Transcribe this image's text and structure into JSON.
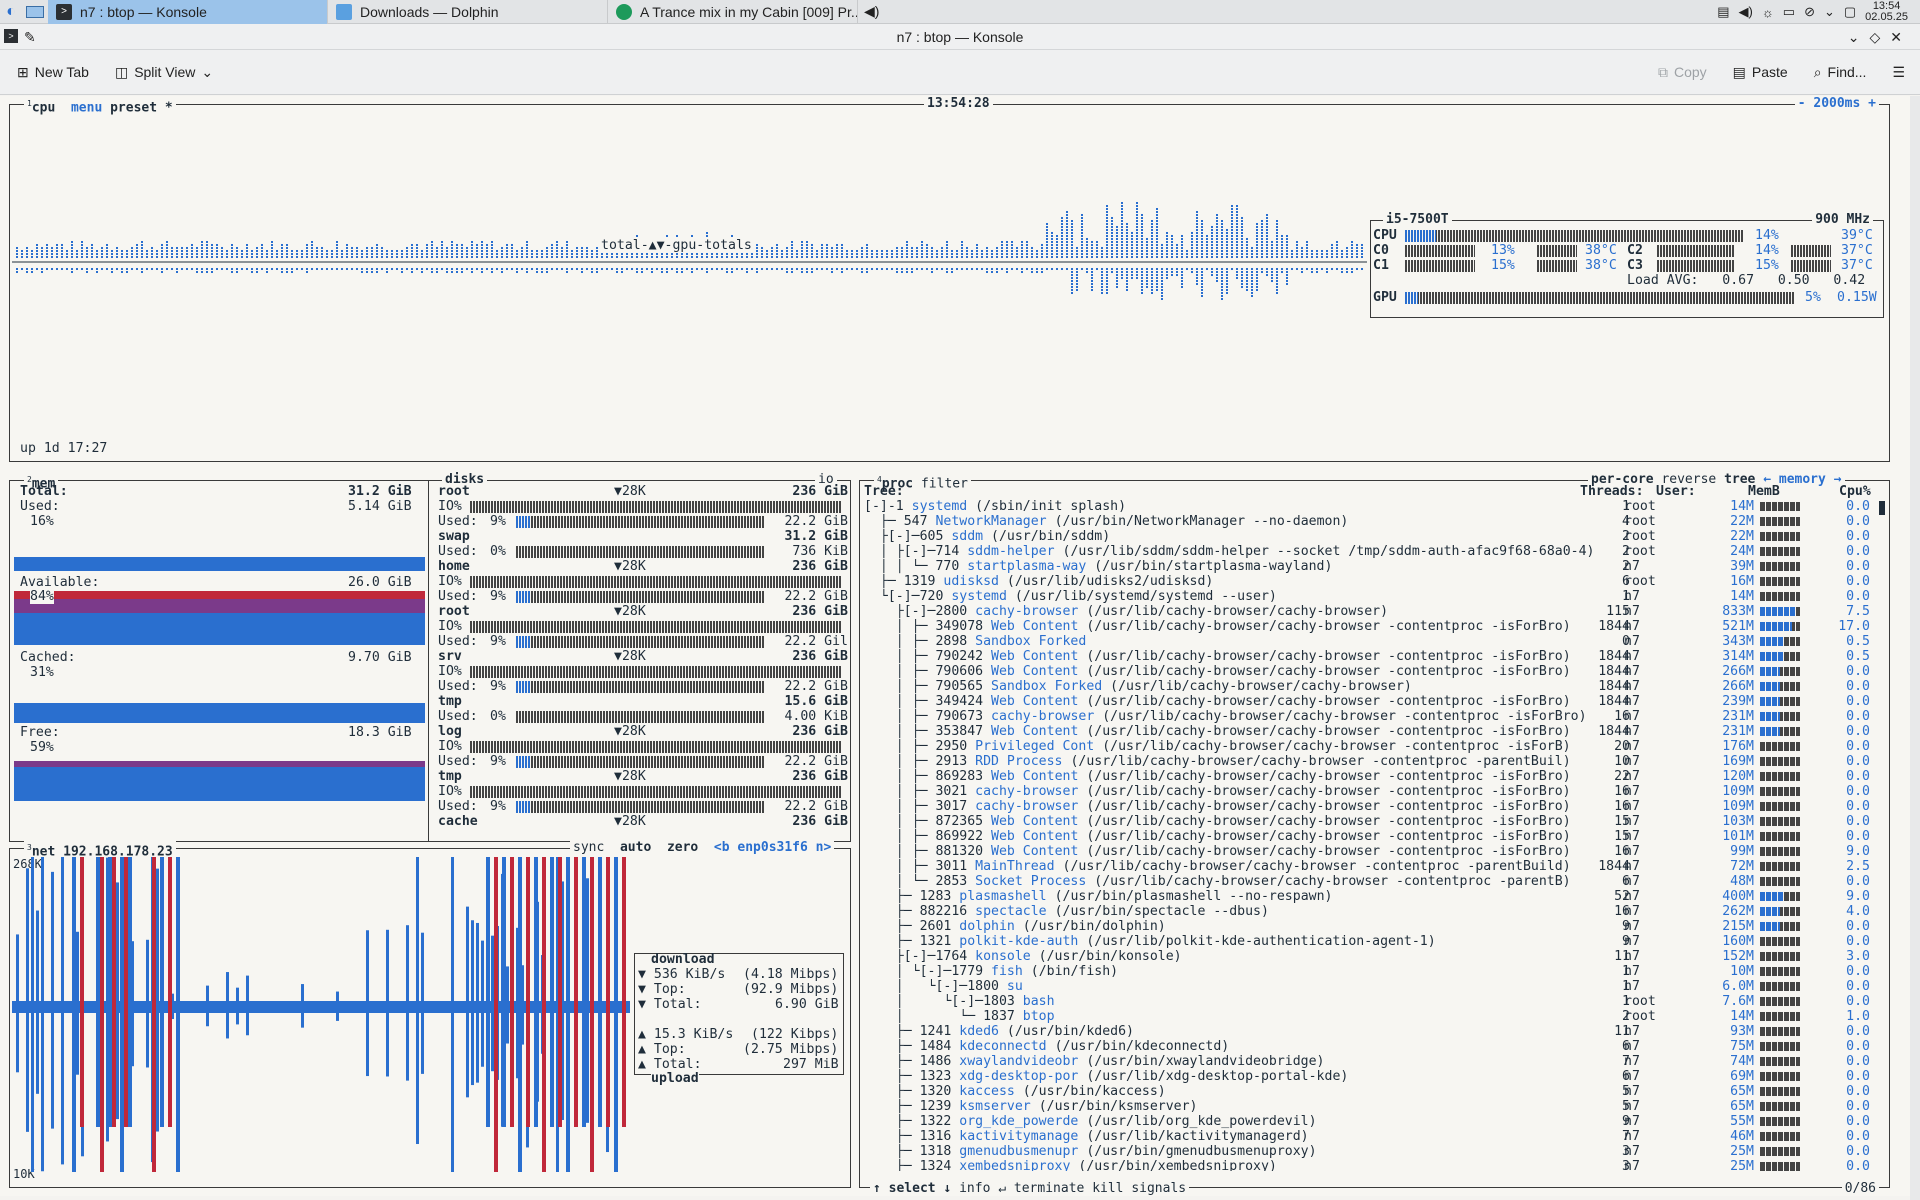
{
  "taskbar": {
    "apps": [
      {
        "label": "n7 : btop — Konsole",
        "active": true
      },
      {
        "label": "Downloads — Dolphin",
        "active": false
      },
      {
        "label": "A Trance mix in my Cabin [009] Pr...",
        "active": false
      }
    ],
    "clock": {
      "time": "13:54",
      "date": "02.05.25"
    }
  },
  "window": {
    "title": "n7 : btop — Konsole"
  },
  "toolbar": {
    "new_tab": "New Tab",
    "split_view": "Split View",
    "copy": "Copy",
    "paste": "Paste",
    "find": "Find..."
  },
  "cpu": {
    "label_num": "1",
    "label": "cpu",
    "menu": "menu",
    "preset": "preset *",
    "time": "13:54:28",
    "interval": "- 2000ms +",
    "graph_label": "total-▲▼-gpu-totals",
    "uptime": "up 1d 17:27",
    "model": "i5-7500T",
    "freq": "900 MHz",
    "cores": [
      {
        "name": "CPU",
        "pct": "14%",
        "temp": "39°C",
        "value": 14
      },
      {
        "name": "C0",
        "pct": "13%",
        "temp": "38°C",
        "value": 13
      },
      {
        "name": "C2",
        "pct": "14%",
        "temp": "37°C",
        "value": 14
      },
      {
        "name": "C1",
        "pct": "15%",
        "temp": "38°C",
        "value": 15
      },
      {
        "name": "C3",
        "pct": "15%",
        "temp": "37°C",
        "value": 15
      }
    ],
    "load_avg": "Load AVG:   0.67   0.50   0.42",
    "gpu": {
      "name": "GPU",
      "pct": "5%",
      "power": "0.15W",
      "value": 5
    }
  },
  "mem": {
    "label_num": "2",
    "label": "mem",
    "total_label": "Total:",
    "total": "31.2 GiB",
    "rows": [
      {
        "label": "Used:",
        "value": "5.14 GiB",
        "pct": "16%"
      },
      {
        "label": "Available:",
        "value": "26.0 GiB",
        "pct": "84%"
      },
      {
        "label": "Cached:",
        "value": "9.70 GiB",
        "pct": "31%"
      },
      {
        "label": "Free:",
        "value": "18.3 GiB",
        "pct": "59%"
      }
    ]
  },
  "disks": {
    "label": "disks",
    "io": "io",
    "items": [
      {
        "name": "root",
        "io_speed": "▼28K",
        "size": "236 GiB",
        "io": "IO%",
        "used": "Used:",
        "pct": "9%",
        "used_val": "22.2 GiB",
        "used_frac": 0.09
      },
      {
        "name": "swap",
        "io_speed": "",
        "size": "31.2 GiB",
        "io": "",
        "used": "Used:",
        "pct": "0%",
        "used_val": "736 KiB",
        "used_frac": 0
      },
      {
        "name": "home",
        "io_speed": "▼28K",
        "size": "236 GiB",
        "io": "IO%",
        "used": "Used:",
        "pct": "9%",
        "used_val": "22.2 GiB",
        "used_frac": 0.09
      },
      {
        "name": "root",
        "io_speed": "▼28K",
        "size": "236 GiB",
        "io": "IO%",
        "used": "Used:",
        "pct": "9%",
        "used_val": "22.2 Gil",
        "used_frac": 0.09
      },
      {
        "name": "srv",
        "io_speed": "▼28K",
        "size": "236 GiB",
        "io": "IO%",
        "used": "Used:",
        "pct": "9%",
        "used_val": "22.2 GiB",
        "used_frac": 0.09
      },
      {
        "name": "tmp",
        "io_speed": "",
        "size": "15.6 GiB",
        "io": "",
        "used": "Used:",
        "pct": "0%",
        "used_val": "4.00 KiB",
        "used_frac": 0
      },
      {
        "name": "log",
        "io_speed": "▼28K",
        "size": "236 GiB",
        "io": "IO%",
        "used": "Used:",
        "pct": "9%",
        "used_val": "22.2 GiB",
        "used_frac": 0.09
      },
      {
        "name": "tmp",
        "io_speed": "▼28K",
        "size": "236 GiB",
        "io": "IO%",
        "used": "Used:",
        "pct": "9%",
        "used_val": "22.2 GiB",
        "used_frac": 0.09
      },
      {
        "name": "cache",
        "io_speed": "▼28K",
        "size": "236 GiB",
        "io": "",
        "used": "",
        "pct": "",
        "used_val": "",
        "used_frac": 0
      }
    ]
  },
  "net": {
    "label_num": "3",
    "label": "net",
    "ip": "192.168.178.23",
    "sync": "sync",
    "auto": "auto",
    "zero": "zero",
    "iface": "<b enp0s31f6 n>",
    "top_scale": "268K",
    "bottom_scale": "10K",
    "download": {
      "title": "download",
      "rate": "536 KiB/s",
      "rate_mbps": "(4.18 Mibps)",
      "top_label": "Top:",
      "top": "(92.9 Mibps)",
      "total_label": "Total:",
      "total": "6.90 GiB"
    },
    "upload": {
      "title": "upload",
      "rate": "15.3 KiB/s",
      "rate_mbps": "(122 Kibps)",
      "top_label": "Top:",
      "top": "(2.75 Mibps)",
      "total_label": "Total:",
      "total": "297 MiB"
    }
  },
  "proc": {
    "label_num": "4",
    "label": "proc",
    "filter": "filter",
    "per_core": "per-core",
    "reverse": "reverse",
    "tree": "tree",
    "sort": "← memory →",
    "headers": {
      "tree": "Tree:",
      "threads": "Threads:",
      "user": "User:",
      "mem": "MemB",
      "cpu": "Cpu%"
    },
    "footer": {
      "select": "↑ select ↓",
      "info": "info ↵",
      "terminate": "terminate",
      "kill": "kill",
      "signals": "signals",
      "count": "0/86"
    },
    "rows": [
      {
        "prefix": "[-]-1 ",
        "name": "systemd",
        "cmd": " (/sbin/init splash)",
        "threads": "1",
        "user": "root",
        "mem": "14M",
        "cpu": "0.0",
        "bar": 0.4
      },
      {
        "prefix": "  ├─ 547 ",
        "name": "NetworkManager",
        "cmd": " (/usr/bin/NetworkManager --no-daemon)",
        "threads": "4",
        "user": "root",
        "mem": "22M",
        "cpu": "0.0",
        "bar": 0.4
      },
      {
        "prefix": "  ├[-]─605 ",
        "name": "sddm",
        "cmd": " (/usr/bin/sddm)",
        "threads": "2",
        "user": "root",
        "mem": "22M",
        "cpu": "0.0",
        "bar": 0.4
      },
      {
        "prefix": "  │ ├[-]─714 ",
        "name": "sddm-helper",
        "cmd": " (/usr/lib/sddm/sddm-helper --socket /tmp/sddm-auth-afac9f68-68a0-4)",
        "threads": "2",
        "user": "root",
        "mem": "24M",
        "cpu": "0.0",
        "bar": 0.4
      },
      {
        "prefix": "  │ │ └─ 770 ",
        "name": "startplasma-way",
        "cmd": " (/usr/bin/startplasma-wayland)",
        "threads": "2",
        "user": "n7",
        "mem": "39M",
        "cpu": "0.0",
        "bar": 0.4
      },
      {
        "prefix": "  ├─ 1319 ",
        "name": "udisksd",
        "cmd": " (/usr/lib/udisks2/udisksd)",
        "threads": "6",
        "user": "root",
        "mem": "16M",
        "cpu": "0.0",
        "bar": 0.4
      },
      {
        "prefix": "  └[-]─720 ",
        "name": "systemd",
        "cmd": " (/usr/lib/systemd/systemd --user)",
        "threads": "1",
        "user": "n7",
        "mem": "14M",
        "cpu": "0.0",
        "bar": 0.4
      },
      {
        "prefix": "    ├[-]─2800 ",
        "name": "cachy-browser",
        "cmd": " (/usr/lib/cachy-browser/cachy-browser)",
        "threads": "115",
        "user": "n7",
        "mem": "833M",
        "cpu": "7.5",
        "bar": 0.9
      },
      {
        "prefix": "    │ ├─ 349078 ",
        "name": "Web Content",
        "cmd": " (/usr/lib/cachy-browser/cachy-browser -contentproc -isForBro)",
        "threads": "1844",
        "user": "n7",
        "mem": "521M",
        "cpu": "17.0",
        "bar": 0.8
      },
      {
        "prefix": "    │ ├─ 2898 ",
        "name": "Sandbox Forked",
        "cmd": "",
        "threads": "0",
        "user": "n7",
        "mem": "343M",
        "cpu": "0.5",
        "bar": 0.6
      },
      {
        "prefix": "    │ ├─ 790242 ",
        "name": "Web Content",
        "cmd": " (/usr/lib/cachy-browser/cachy-browser -contentproc -isForBro)",
        "threads": "1844",
        "user": "n7",
        "mem": "314M",
        "cpu": "0.5",
        "bar": 0.6
      },
      {
        "prefix": "    │ ├─ 790606 ",
        "name": "Web Content",
        "cmd": " (/usr/lib/cachy-browser/cachy-browser -contentproc -isForBro)",
        "threads": "1844",
        "user": "n7",
        "mem": "266M",
        "cpu": "0.0",
        "bar": 0.5
      },
      {
        "prefix": "    │ ├─ 790565 ",
        "name": "Sandbox Forked",
        "cmd": " (/usr/lib/cachy-browser/cachy-browser)",
        "threads": "1844",
        "user": "n7",
        "mem": "266M",
        "cpu": "0.0",
        "bar": 0.5
      },
      {
        "prefix": "    │ ├─ 349424 ",
        "name": "Web Content",
        "cmd": " (/usr/lib/cachy-browser/cachy-browser -contentproc -isForBro)",
        "threads": "1844",
        "user": "n7",
        "mem": "239M",
        "cpu": "0.0",
        "bar": 0.5
      },
      {
        "prefix": "    │ ├─ 790673 ",
        "name": "cachy-browser",
        "cmd": " (/usr/lib/cachy-browser/cachy-browser -contentproc -isForBro)",
        "threads": "16",
        "user": "n7",
        "mem": "231M",
        "cpu": "0.0",
        "bar": 0.5
      },
      {
        "prefix": "    │ ├─ 353847 ",
        "name": "Web Content",
        "cmd": " (/usr/lib/cachy-browser/cachy-browser -contentproc -isForBro)",
        "threads": "1844",
        "user": "n7",
        "mem": "231M",
        "cpu": "0.0",
        "bar": 0.5
      },
      {
        "prefix": "    │ ├─ 2950 ",
        "name": "Privileged Cont",
        "cmd": " (/usr/lib/cachy-browser/cachy-browser -contentproc -isForB)",
        "threads": "20",
        "user": "n7",
        "mem": "176M",
        "cpu": "0.0",
        "bar": 0.4
      },
      {
        "prefix": "    │ ├─ 2913 ",
        "name": "RDD Process",
        "cmd": " (/usr/lib/cachy-browser/cachy-browser -contentproc -parentBuil)",
        "threads": "10",
        "user": "n7",
        "mem": "169M",
        "cpu": "0.0",
        "bar": 0.4
      },
      {
        "prefix": "    │ ├─ 869283 ",
        "name": "Web Content",
        "cmd": " (/usr/lib/cachy-browser/cachy-browser -contentproc -isForBro)",
        "threads": "22",
        "user": "n7",
        "mem": "120M",
        "cpu": "0.0",
        "bar": 0.4
      },
      {
        "prefix": "    │ ├─ 3021 ",
        "name": "cachy-browser",
        "cmd": " (/usr/lib/cachy-browser/cachy-browser -contentproc -isForBro)",
        "threads": "16",
        "user": "n7",
        "mem": "109M",
        "cpu": "0.0",
        "bar": 0.4
      },
      {
        "prefix": "    │ ├─ 3017 ",
        "name": "cachy-browser",
        "cmd": " (/usr/lib/cachy-browser/cachy-browser -contentproc -isForBro)",
        "threads": "16",
        "user": "n7",
        "mem": "109M",
        "cpu": "0.0",
        "bar": 0.4
      },
      {
        "prefix": "    │ ├─ 872365 ",
        "name": "Web Content",
        "cmd": " (/usr/lib/cachy-browser/cachy-browser -contentproc -isForBro)",
        "threads": "15",
        "user": "n7",
        "mem": "103M",
        "cpu": "0.0",
        "bar": 0.4
      },
      {
        "prefix": "    │ ├─ 869922 ",
        "name": "Web Content",
        "cmd": " (/usr/lib/cachy-browser/cachy-browser -contentproc -isForBro)",
        "threads": "15",
        "user": "n7",
        "mem": "101M",
        "cpu": "0.0",
        "bar": 0.4
      },
      {
        "prefix": "    │ ├─ 881320 ",
        "name": "Web Content",
        "cmd": " (/usr/lib/cachy-browser/cachy-browser -contentproc -isForBro)",
        "threads": "16",
        "user": "n7",
        "mem": "99M",
        "cpu": "9.0",
        "bar": 0.4
      },
      {
        "prefix": "    │ ├─ 3011 ",
        "name": "MainThread",
        "cmd": " (/usr/lib/cachy-browser/cachy-browser -contentproc -parentBuild)",
        "threads": "1844",
        "user": "n7",
        "mem": "72M",
        "cpu": "2.5",
        "bar": 0.4
      },
      {
        "prefix": "    │ └─ 2853 ",
        "name": "Socket Process",
        "cmd": " (/usr/lib/cachy-browser/cachy-browser -contentproc -parentB)",
        "threads": "6",
        "user": "n7",
        "mem": "48M",
        "cpu": "0.0",
        "bar": 0.4
      },
      {
        "prefix": "    ├─ 1283 ",
        "name": "plasmashell",
        "cmd": " (/usr/bin/plasmashell --no-respawn)",
        "threads": "52",
        "user": "n7",
        "mem": "400M",
        "cpu": "9.0",
        "bar": 0.6
      },
      {
        "prefix": "    ├─ 882216 ",
        "name": "spectacle",
        "cmd": " (/usr/bin/spectacle --dbus)",
        "threads": "16",
        "user": "n7",
        "mem": "262M",
        "cpu": "4.0",
        "bar": 0.5
      },
      {
        "prefix": "    ├─ 2601 ",
        "name": "dolphin",
        "cmd": " (/usr/bin/dolphin)",
        "threads": "9",
        "user": "n7",
        "mem": "215M",
        "cpu": "0.0",
        "bar": 0.5
      },
      {
        "prefix": "    ├─ 1321 ",
        "name": "polkit-kde-auth",
        "cmd": " (/usr/lib/polkit-kde-authentication-agent-1)",
        "threads": "9",
        "user": "n7",
        "mem": "160M",
        "cpu": "0.0",
        "bar": 0.4
      },
      {
        "prefix": "    ├[-]─1764 ",
        "name": "konsole",
        "cmd": " (/usr/bin/konsole)",
        "threads": "11",
        "user": "n7",
        "mem": "152M",
        "cpu": "3.0",
        "bar": 0.4
      },
      {
        "prefix": "    │ └[-]─1779 ",
        "name": "fish",
        "cmd": " (/bin/fish)",
        "threads": "1",
        "user": "n7",
        "mem": "10M",
        "cpu": "0.0",
        "bar": 0.4
      },
      {
        "prefix": "    │   └[-]─1800 ",
        "name": "su",
        "cmd": "",
        "threads": "1",
        "user": "n7",
        "mem": "6.0M",
        "cpu": "0.0",
        "bar": 0.4
      },
      {
        "prefix": "    │     └[-]─1803 ",
        "name": "bash",
        "cmd": "",
        "threads": "1",
        "user": "root",
        "mem": "7.6M",
        "cpu": "0.0",
        "bar": 0.4
      },
      {
        "prefix": "    │       └─ 1837 ",
        "name": "btop",
        "cmd": "",
        "threads": "2",
        "user": "root",
        "mem": "14M",
        "cpu": "1.0",
        "bar": 0.4
      },
      {
        "prefix": "    ├─ 1241 ",
        "name": "kded6",
        "cmd": " (/usr/bin/kded6)",
        "threads": "11",
        "user": "n7",
        "mem": "93M",
        "cpu": "0.0",
        "bar": 0.4
      },
      {
        "prefix": "    ├─ 1484 ",
        "name": "kdeconnectd",
        "cmd": " (/usr/bin/kdeconnectd)",
        "threads": "6",
        "user": "n7",
        "mem": "75M",
        "cpu": "0.0",
        "bar": 0.4
      },
      {
        "prefix": "    ├─ 1486 ",
        "name": "xwaylandvideobr",
        "cmd": " (/usr/bin/xwaylandvideobridge)",
        "threads": "7",
        "user": "n7",
        "mem": "74M",
        "cpu": "0.0",
        "bar": 0.4
      },
      {
        "prefix": "    ├─ 1323 ",
        "name": "xdg-desktop-por",
        "cmd": " (/usr/lib/xdg-desktop-portal-kde)",
        "threads": "6",
        "user": "n7",
        "mem": "69M",
        "cpu": "0.0",
        "bar": 0.4
      },
      {
        "prefix": "    ├─ 1320 ",
        "name": "kaccess",
        "cmd": " (/usr/bin/kaccess)",
        "threads": "5",
        "user": "n7",
        "mem": "65M",
        "cpu": "0.0",
        "bar": 0.4
      },
      {
        "prefix": "    ├─ 1239 ",
        "name": "ksmserver",
        "cmd": " (/usr/bin/ksmserver)",
        "threads": "5",
        "user": "n7",
        "mem": "65M",
        "cpu": "0.0",
        "bar": 0.4
      },
      {
        "prefix": "    ├─ 1322 ",
        "name": "org_kde_powerde",
        "cmd": " (/usr/lib/org_kde_powerdevil)",
        "threads": "9",
        "user": "n7",
        "mem": "55M",
        "cpu": "0.0",
        "bar": 0.4
      },
      {
        "prefix": "    ├─ 1316 ",
        "name": "kactivitymanage",
        "cmd": " (/usr/lib/kactivitymanagerd)",
        "threads": "7",
        "user": "n7",
        "mem": "46M",
        "cpu": "0.0",
        "bar": 0.4
      },
      {
        "prefix": "    ├─ 1318 ",
        "name": "gmenudbusmenupr",
        "cmd": " (/usr/bin/gmenudbusmenuproxy)",
        "threads": "3",
        "user": "n7",
        "mem": "25M",
        "cpu": "0.0",
        "bar": 0.4
      },
      {
        "prefix": "    ├─ 1324 ",
        "name": "xembedsniproxy",
        "cmd": " (/usr/bin/xembedsniproxy)",
        "threads": "3",
        "user": "n7",
        "mem": "25M",
        "cpu": "0.0",
        "bar": 0.4
      }
    ]
  },
  "colors": {
    "accent": "#2a6fcf",
    "red": "#c0283a",
    "border": "#3a3a3a"
  }
}
